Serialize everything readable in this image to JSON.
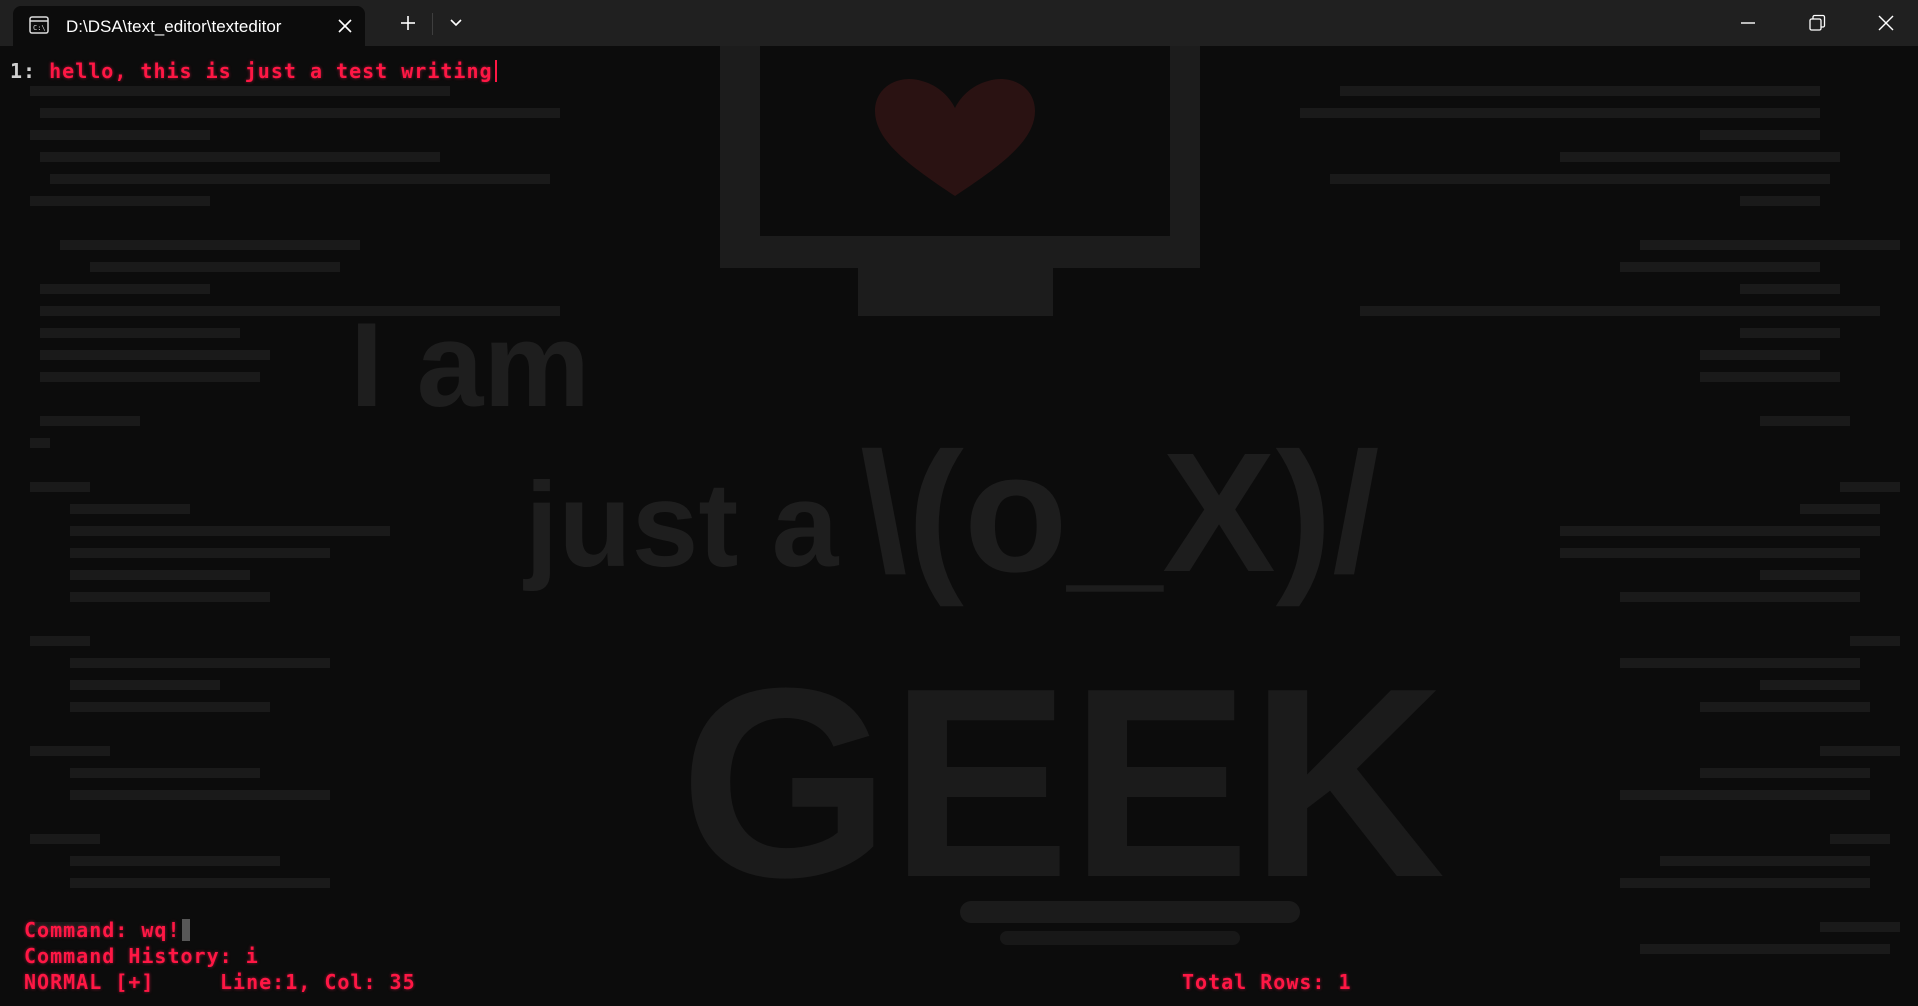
{
  "window": {
    "tab_title": "D:\\DSA\\text_editor\\texteditor",
    "icons": {
      "tab": "terminal-icon",
      "close_tab": "close-icon",
      "new_tab": "plus-icon",
      "dropdown": "chevron-down-icon",
      "minimize": "minimize-icon",
      "maximize": "restore-icon",
      "close_window": "close-icon"
    }
  },
  "background": {
    "text_line1": "I am",
    "text_line2": "just a",
    "emoticon": "\\(o_X)/",
    "big_word": "GEEK"
  },
  "editor": {
    "line_number": "1:",
    "line_text": "hello, this is just a test writing"
  },
  "command": {
    "label": "Command: wq!",
    "history": "Command History: i"
  },
  "status": {
    "mode": "NORMAL [+]",
    "position": "Line:1, Col: 35",
    "total_rows": "Total Rows: 1"
  },
  "colors": {
    "terminal_bg": "#0c0c0c",
    "titlebar_bg": "#202020",
    "accent": "#ff1744"
  }
}
